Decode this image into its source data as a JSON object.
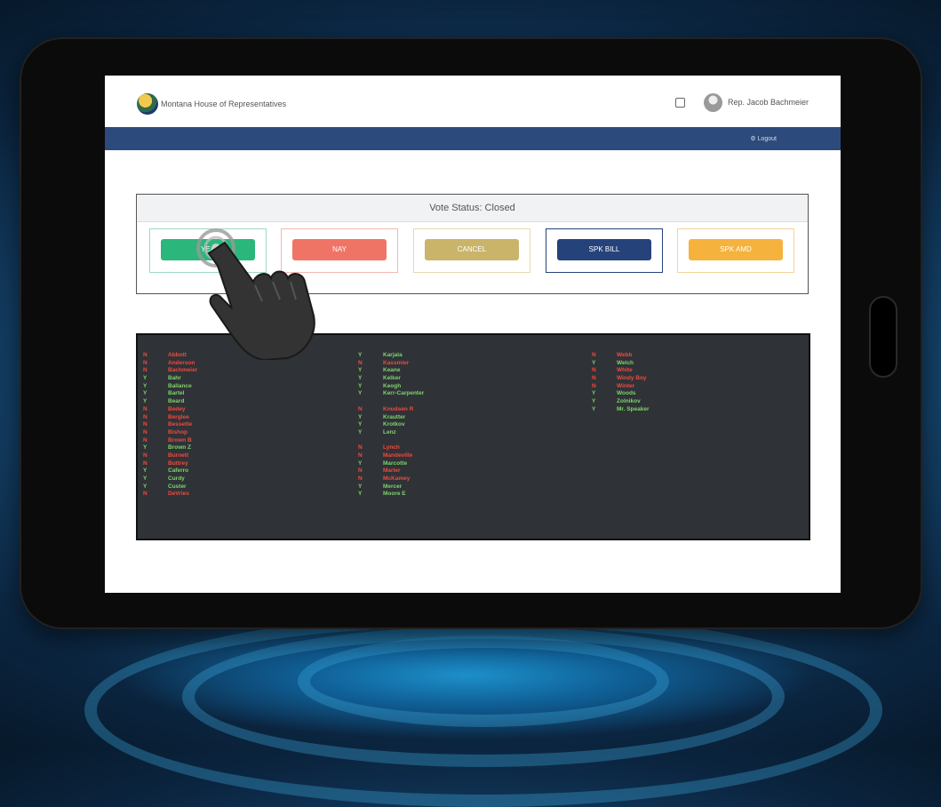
{
  "header": {
    "site_title": "Montana House of Representatives",
    "user_name": "Rep. Jacob Bachmeier",
    "logout_label": "⚙ Logout"
  },
  "vote": {
    "status_label": "Vote Status: Closed",
    "buttons": [
      "YEA",
      "NAY",
      "CANCEL",
      "SPK BILL",
      "SPK AMD"
    ]
  },
  "roster": {
    "columns": [
      [
        {
          "vote": "N",
          "name": "Abbott"
        },
        {
          "vote": "N",
          "name": "Anderson"
        },
        {
          "vote": "N",
          "name": "Bachmeier"
        },
        {
          "vote": "Y",
          "name": "Bahr"
        },
        {
          "vote": "Y",
          "name": "Ballance"
        },
        {
          "vote": "Y",
          "name": "Bartel"
        },
        {
          "vote": "Y",
          "name": "Beard"
        },
        {
          "vote": "N",
          "name": "Bedey"
        },
        {
          "vote": "N",
          "name": "Berglee"
        },
        {
          "vote": "N",
          "name": "Bessette"
        },
        {
          "vote": "N",
          "name": "Bishop"
        },
        {
          "vote": "N",
          "name": "Brown B"
        },
        {
          "vote": "Y",
          "name": "Brown Z"
        },
        {
          "vote": "N",
          "name": "Burnett"
        },
        {
          "vote": "N",
          "name": "Buttrey"
        },
        {
          "vote": "Y",
          "name": "Caferro"
        },
        {
          "vote": "Y",
          "name": "Curdy"
        },
        {
          "vote": "Y",
          "name": "Custer"
        },
        {
          "vote": "N",
          "name": "DeVries"
        }
      ],
      [
        {
          "vote": "Y",
          "name": "Karjala"
        },
        {
          "vote": "N",
          "name": "Kassmier"
        },
        {
          "vote": "Y",
          "name": "Keane"
        },
        {
          "vote": "Y",
          "name": "Kelker"
        },
        {
          "vote": "Y",
          "name": "Keogh"
        },
        {
          "vote": "Y",
          "name": "Kerr-Carpenter"
        },
        {
          "vote": "",
          "name": ""
        },
        {
          "vote": "N",
          "name": "Knudsen R"
        },
        {
          "vote": "Y",
          "name": "Krautter"
        },
        {
          "vote": "Y",
          "name": "Krotkov"
        },
        {
          "vote": "Y",
          "name": "Lenz"
        },
        {
          "vote": "",
          "name": ""
        },
        {
          "vote": "N",
          "name": "Lynch"
        },
        {
          "vote": "N",
          "name": "Mandeville"
        },
        {
          "vote": "Y",
          "name": "Marcotte"
        },
        {
          "vote": "N",
          "name": "Marler"
        },
        {
          "vote": "N",
          "name": "McKamey"
        },
        {
          "vote": "Y",
          "name": "Mercer"
        },
        {
          "vote": "Y",
          "name": "Moore E"
        }
      ],
      [
        {
          "vote": "N",
          "name": "Webb"
        },
        {
          "vote": "Y",
          "name": "Welch"
        },
        {
          "vote": "N",
          "name": "White"
        },
        {
          "vote": "N",
          "name": "Windy Boy"
        },
        {
          "vote": "N",
          "name": "Winter"
        },
        {
          "vote": "Y",
          "name": "Woods"
        },
        {
          "vote": "Y",
          "name": "Zolnikov"
        },
        {
          "vote": "Y",
          "name": "Mr. Speaker"
        }
      ]
    ]
  },
  "colors": {
    "yea": "#2bb67c",
    "nay": "#f07466",
    "cancel": "#c9b46a",
    "spk_bill": "#26427a",
    "spk_amd": "#f5b23d",
    "yes_text": "#7fd36b",
    "no_text": "#f04a3e"
  }
}
